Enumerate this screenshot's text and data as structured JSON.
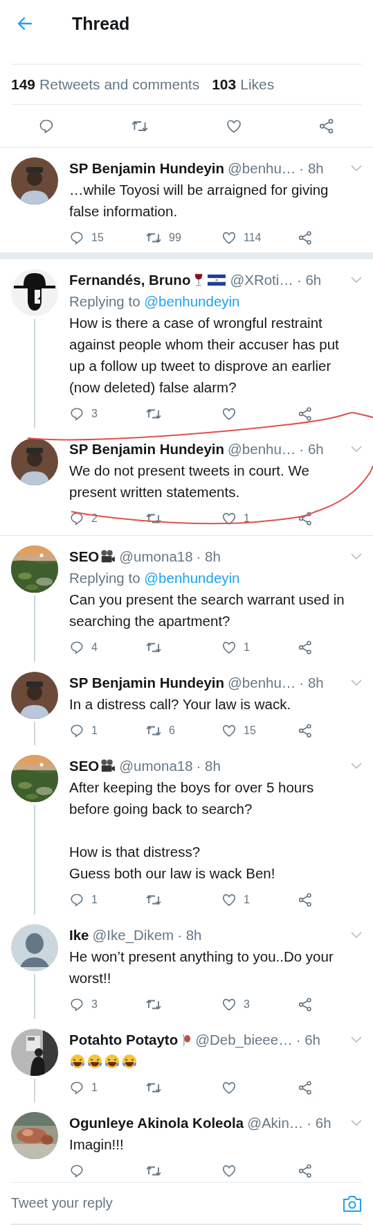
{
  "header": {
    "title": "Thread"
  },
  "stats": [
    {
      "count": "149",
      "label": "Retweets and comments"
    },
    {
      "count": "103",
      "label": "Likes"
    }
  ],
  "tweets": [
    {
      "avatar": {
        "kind": "person"
      },
      "name": "SP Benjamin Hundeyin",
      "handle": "@benhu…",
      "time": "· 8h",
      "body": "…while Toyosi will be arraigned for giving false information.",
      "replies": "15",
      "retweets": "99",
      "likes": "114",
      "section_break": true
    },
    {
      "avatar": {
        "kind": "hat-figure"
      },
      "name": "Fernandés, Bruno",
      "name_icons": [
        {
          "kind": "wine-glass"
        },
        {
          "kind": "flag"
        }
      ],
      "handle": "@XRoti…",
      "time": "· 6h",
      "replying": {
        "label": "Replying to",
        "handle": "@benhundeyin"
      },
      "body": "How is there a case of wrongful restraint against people whom their accuser has put up a follow up tweet to disprove an earlier (now deleted) false alarm?",
      "replies": "3",
      "thread_line": true
    },
    {
      "avatar": {
        "kind": "person"
      },
      "name": "SP Benjamin Hundeyin",
      "handle": "@benhu…",
      "time": "· 6h",
      "body": "We do not present tweets in court. We present written statements.",
      "replies": "2",
      "likes": "1",
      "divider": true
    },
    {
      "avatar": {
        "kind": "landscape"
      },
      "name": "SEO",
      "name_icons": [
        {
          "kind": "projector"
        }
      ],
      "handle": "@umona18",
      "time": "· 8h",
      "replying": {
        "label": "Replying to",
        "handle": "@benhundeyin"
      },
      "body": "Can you present the search warrant used in searching the apartment?",
      "replies": "4",
      "likes": "1",
      "thread_line": true
    },
    {
      "avatar": {
        "kind": "person"
      },
      "name": "SP Benjamin Hundeyin",
      "handle": "@benhu…",
      "time": "· 8h",
      "body": "In a distress call? Your law is wack.",
      "replies": "1",
      "retweets": "6",
      "likes": "15",
      "thread_line": true
    },
    {
      "avatar": {
        "kind": "landscape"
      },
      "name": "SEO",
      "name_icons": [
        {
          "kind": "projector"
        }
      ],
      "handle": "@umona18",
      "time": "· 8h",
      "body": "After keeping the boys for over 5 hours before going back to search?\n\nHow is that distress?\nGuess both our law is wack Ben!",
      "replies": "1",
      "likes": "1",
      "thread_line": true
    },
    {
      "avatar": {
        "kind": "default"
      },
      "name": "Ike",
      "handle": "@Ike_Dikem",
      "time": "· 8h",
      "body": "He won’t present anything to you..Do your worst!!",
      "replies": "3",
      "likes": "3",
      "thread_line": true
    },
    {
      "avatar": {
        "kind": "grayscale-photo"
      },
      "name": "Potahto Potayto",
      "name_icons": [
        {
          "kind": "rose"
        }
      ],
      "handle": "@Deb_bieee…",
      "time": "· 6h",
      "emoji": [
        {
          "kind": "laughing"
        },
        {
          "kind": "laughing"
        },
        {
          "kind": "laughing"
        },
        {
          "kind": "laughing"
        }
      ],
      "replies": "1",
      "thread_line": true
    },
    {
      "avatar": {
        "kind": "dog-photo"
      },
      "name": "Ogunleye Akinola Koleola",
      "handle": "@Akin…",
      "time": "· 6h",
      "body": "Imagin!!!"
    }
  ],
  "reply_box": {
    "placeholder": "Tweet your reply"
  }
}
